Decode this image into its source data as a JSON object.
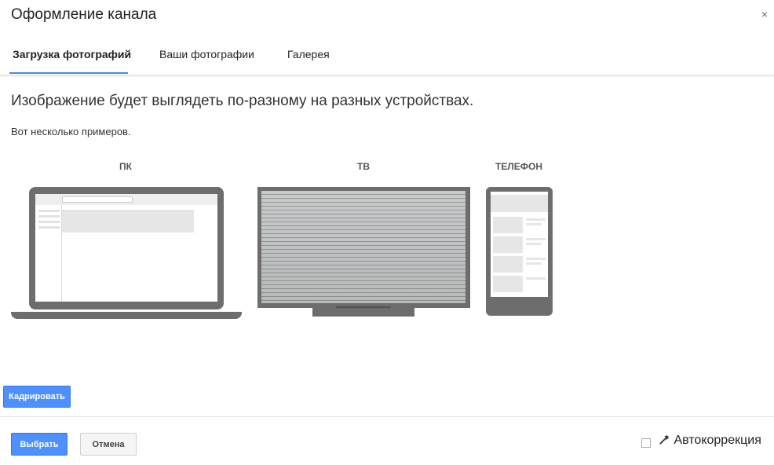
{
  "dialog": {
    "title": "Оформление канала",
    "close_label": "×"
  },
  "tabs": [
    {
      "label": "Загрузка фотографий",
      "active": true
    },
    {
      "label": "Ваши фотографии",
      "active": false
    },
    {
      "label": "Галерея",
      "active": false
    }
  ],
  "content": {
    "headline": "Изображение будет выглядеть по-разному на разных устройствах.",
    "subtext": "Вот несколько примеров."
  },
  "devices": [
    {
      "label": "ПК"
    },
    {
      "label": "ТВ"
    },
    {
      "label": "ТЕЛЕФОН"
    }
  ],
  "buttons": {
    "crop": "Кадрировать",
    "select": "Выбрать",
    "cancel": "Отмена"
  },
  "autocorrect": {
    "label": "Автокоррекция",
    "icon": "magic-wand-icon",
    "checked": false
  },
  "colors": {
    "accent": "#4d90fe",
    "device_frame": "#6d6d6d"
  }
}
